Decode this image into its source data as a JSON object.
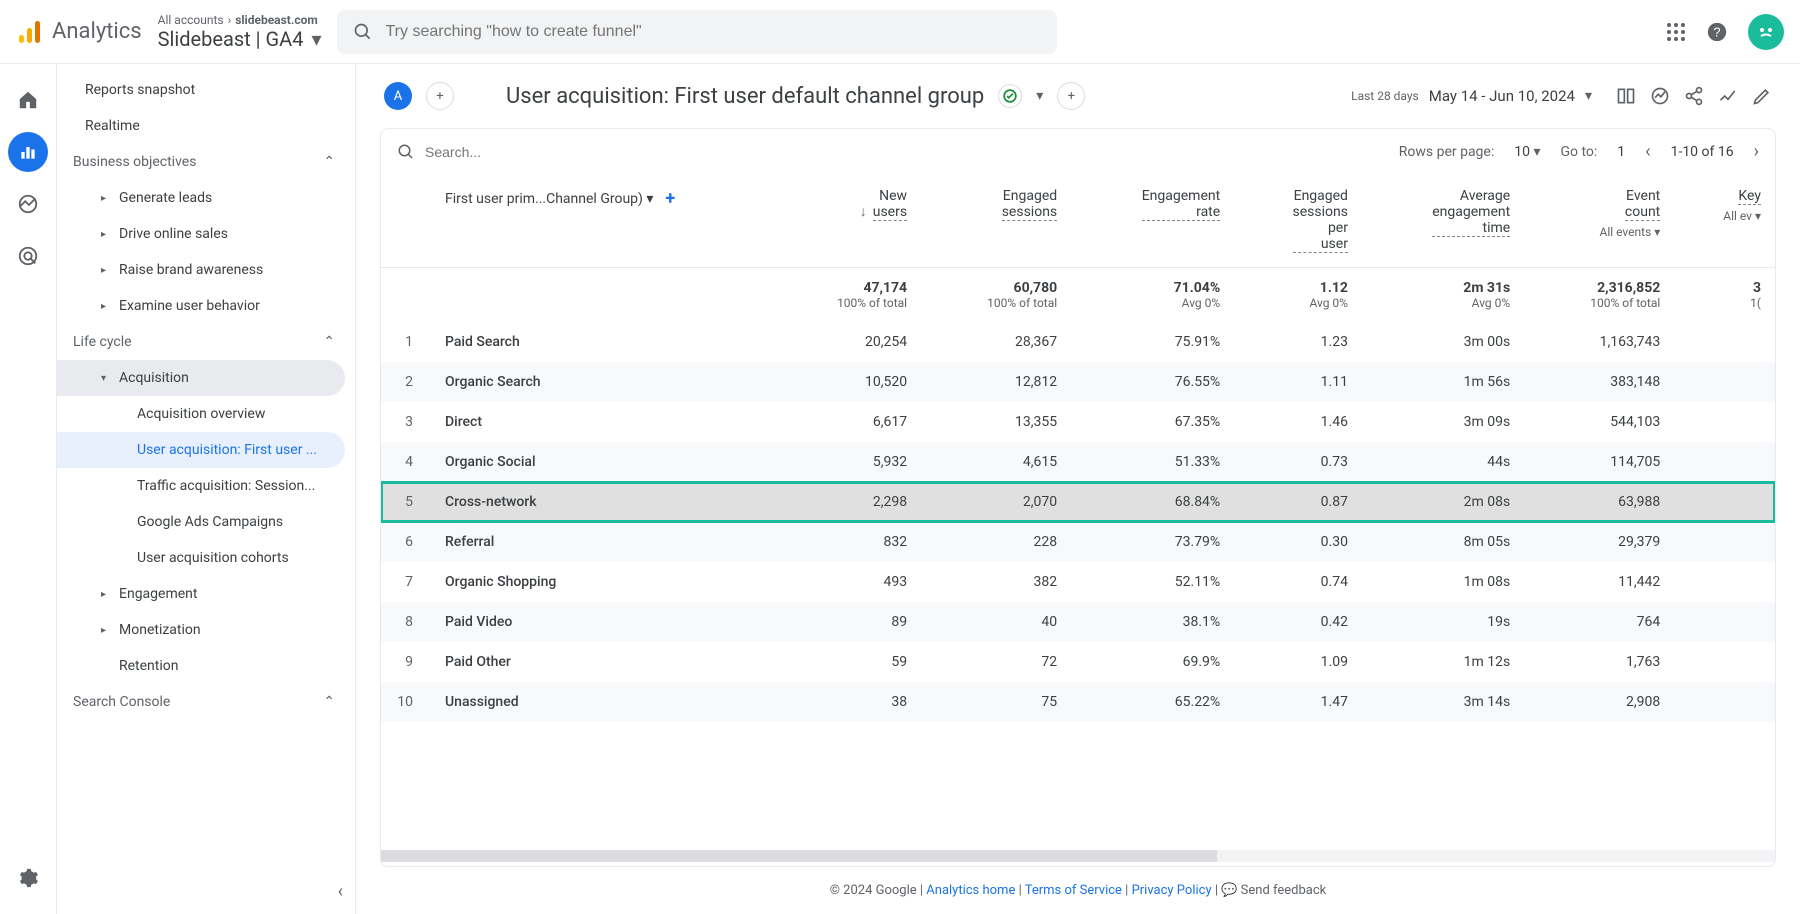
{
  "header": {
    "brand": "Analytics",
    "breadcrumb_all": "All accounts",
    "breadcrumb_prop": "slidebeast.com",
    "property": "Slidebeast  | GA4",
    "search_placeholder": "Try searching \"how to create funnel\""
  },
  "sidebar": {
    "snapshot": "Reports snapshot",
    "realtime": "Realtime",
    "bo": "Business objectives",
    "bo_items": [
      "Generate leads",
      "Drive online sales",
      "Raise brand awareness",
      "Examine user behavior"
    ],
    "lc": "Life cycle",
    "acq": "Acquisition",
    "acq_items": [
      "Acquisition overview",
      "User acquisition: First user ...",
      "Traffic acquisition: Session...",
      "Google Ads Campaigns",
      "User acquisition cohorts"
    ],
    "engagement": "Engagement",
    "monetization": "Monetization",
    "retention": "Retention",
    "search_console": "Search Console"
  },
  "title": {
    "chip": "A",
    "text": "User acquisition: First user default channel group",
    "plus": "+",
    "date_label": "Last 28 days",
    "date_range": "May 14 - Jun 10, 2024"
  },
  "controls": {
    "search_ph": "Search...",
    "rpp_label": "Rows per page:",
    "rpp_val": "10",
    "goto_label": "Go to:",
    "goto_val": "1",
    "range": "1-10 of 16"
  },
  "table": {
    "dim_label": "First user prim...Channel Group)",
    "cols": [
      {
        "name": "New users",
        "sub": ""
      },
      {
        "name": "Engaged sessions",
        "sub": ""
      },
      {
        "name": "Engagement rate",
        "sub": ""
      },
      {
        "name": "Engaged sessions per user",
        "sub": ""
      },
      {
        "name": "Average engagement time",
        "sub": ""
      },
      {
        "name": "Event count",
        "sub": "All events"
      },
      {
        "name": "Key",
        "sub": "All ev"
      }
    ],
    "totals": {
      "vals": [
        "47,174",
        "60,780",
        "71.04%",
        "1.12",
        "2m 31s",
        "2,316,852",
        "3"
      ],
      "subs": [
        "100% of total",
        "100% of total",
        "Avg 0%",
        "Avg 0%",
        "Avg 0%",
        "100% of total",
        "1("
      ]
    },
    "rows": [
      {
        "idx": "1",
        "name": "Paid Search",
        "vals": [
          "20,254",
          "28,367",
          "75.91%",
          "1.23",
          "3m 00s",
          "1,163,743",
          ""
        ]
      },
      {
        "idx": "2",
        "name": "Organic Search",
        "vals": [
          "10,520",
          "12,812",
          "76.55%",
          "1.11",
          "1m 56s",
          "383,148",
          ""
        ]
      },
      {
        "idx": "3",
        "name": "Direct",
        "vals": [
          "6,617",
          "13,355",
          "67.35%",
          "1.46",
          "3m 09s",
          "544,103",
          ""
        ]
      },
      {
        "idx": "4",
        "name": "Organic Social",
        "vals": [
          "5,932",
          "4,615",
          "51.33%",
          "0.73",
          "44s",
          "114,705",
          ""
        ]
      },
      {
        "idx": "5",
        "name": "Cross-network",
        "vals": [
          "2,298",
          "2,070",
          "68.84%",
          "0.87",
          "2m 08s",
          "63,988",
          ""
        ],
        "hl": true
      },
      {
        "idx": "6",
        "name": "Referral",
        "vals": [
          "832",
          "228",
          "73.79%",
          "0.30",
          "8m 05s",
          "29,379",
          ""
        ]
      },
      {
        "idx": "7",
        "name": "Organic Shopping",
        "vals": [
          "493",
          "382",
          "52.11%",
          "0.74",
          "1m 08s",
          "11,442",
          ""
        ]
      },
      {
        "idx": "8",
        "name": "Paid Video",
        "vals": [
          "89",
          "40",
          "38.1%",
          "0.42",
          "19s",
          "764",
          ""
        ]
      },
      {
        "idx": "9",
        "name": "Paid Other",
        "vals": [
          "59",
          "72",
          "69.9%",
          "1.09",
          "1m 12s",
          "1,763",
          ""
        ]
      },
      {
        "idx": "10",
        "name": "Unassigned",
        "vals": [
          "38",
          "75",
          "65.22%",
          "1.47",
          "3m 14s",
          "2,908",
          ""
        ]
      }
    ]
  },
  "footer": {
    "copy": "© 2024 Google",
    "home": "Analytics home",
    "tos": "Terms of Service",
    "pp": "Privacy Policy",
    "fb": "Send feedback"
  }
}
